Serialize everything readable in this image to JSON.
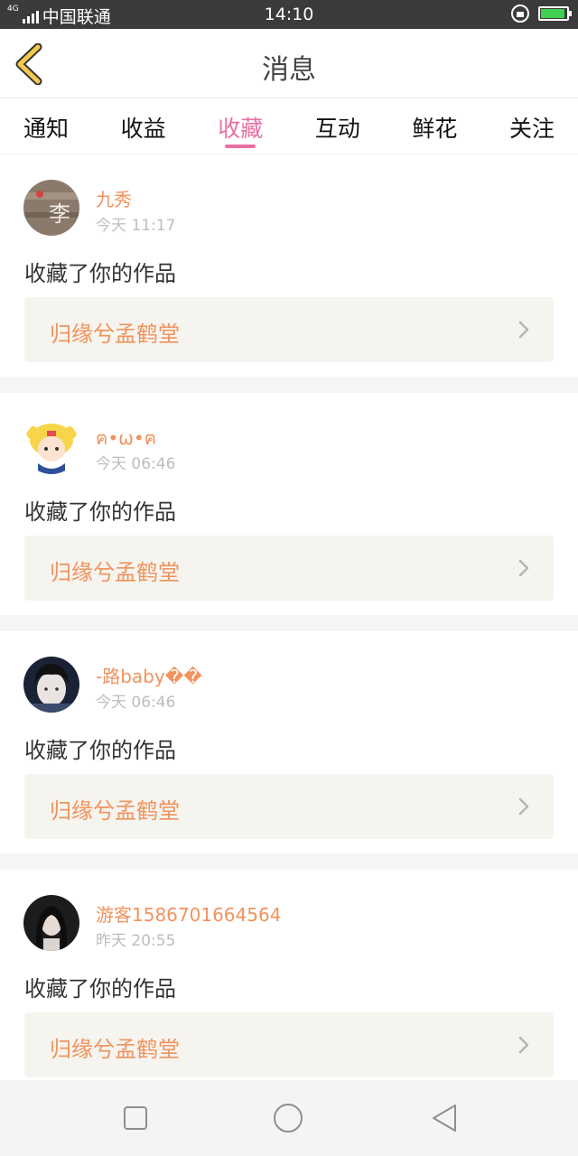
{
  "status_bar": {
    "network": "4G",
    "carrier": "中国联通",
    "time": "14:10",
    "battery_color": "#3fcf52"
  },
  "header": {
    "title": "消息",
    "back_icon": "chevron-left-icon",
    "back_icon_color": "#f2c94c"
  },
  "tabs": [
    {
      "label": "通知",
      "active": false
    },
    {
      "label": "收益",
      "active": false
    },
    {
      "label": "收藏",
      "active": true
    },
    {
      "label": "互动",
      "active": false
    },
    {
      "label": "鲜花",
      "active": false
    },
    {
      "label": "关注",
      "active": false
    }
  ],
  "accent_color": "#e96fa4",
  "name_color": "#f0935e",
  "messages": [
    {
      "username": "九秀",
      "time": "今天 11:17",
      "action": "收藏了你的作品",
      "work_title": "归缘兮孟鹤堂"
    },
    {
      "username": "ฅ•ω•ฅ",
      "time": "今天 06:46",
      "action": "收藏了你的作品",
      "work_title": "归缘兮孟鹤堂"
    },
    {
      "username": "-路baby��",
      "time": "今天 06:46",
      "action": "收藏了你的作品",
      "work_title": "归缘兮孟鹤堂"
    },
    {
      "username": "游客1586701664564",
      "time": "昨天 20:55",
      "action": "收藏了你的作品",
      "work_title": "归缘兮孟鹤堂"
    }
  ],
  "nav_bar": {
    "buttons": [
      "square-recents-icon",
      "circle-home-icon",
      "triangle-back-icon"
    ]
  }
}
